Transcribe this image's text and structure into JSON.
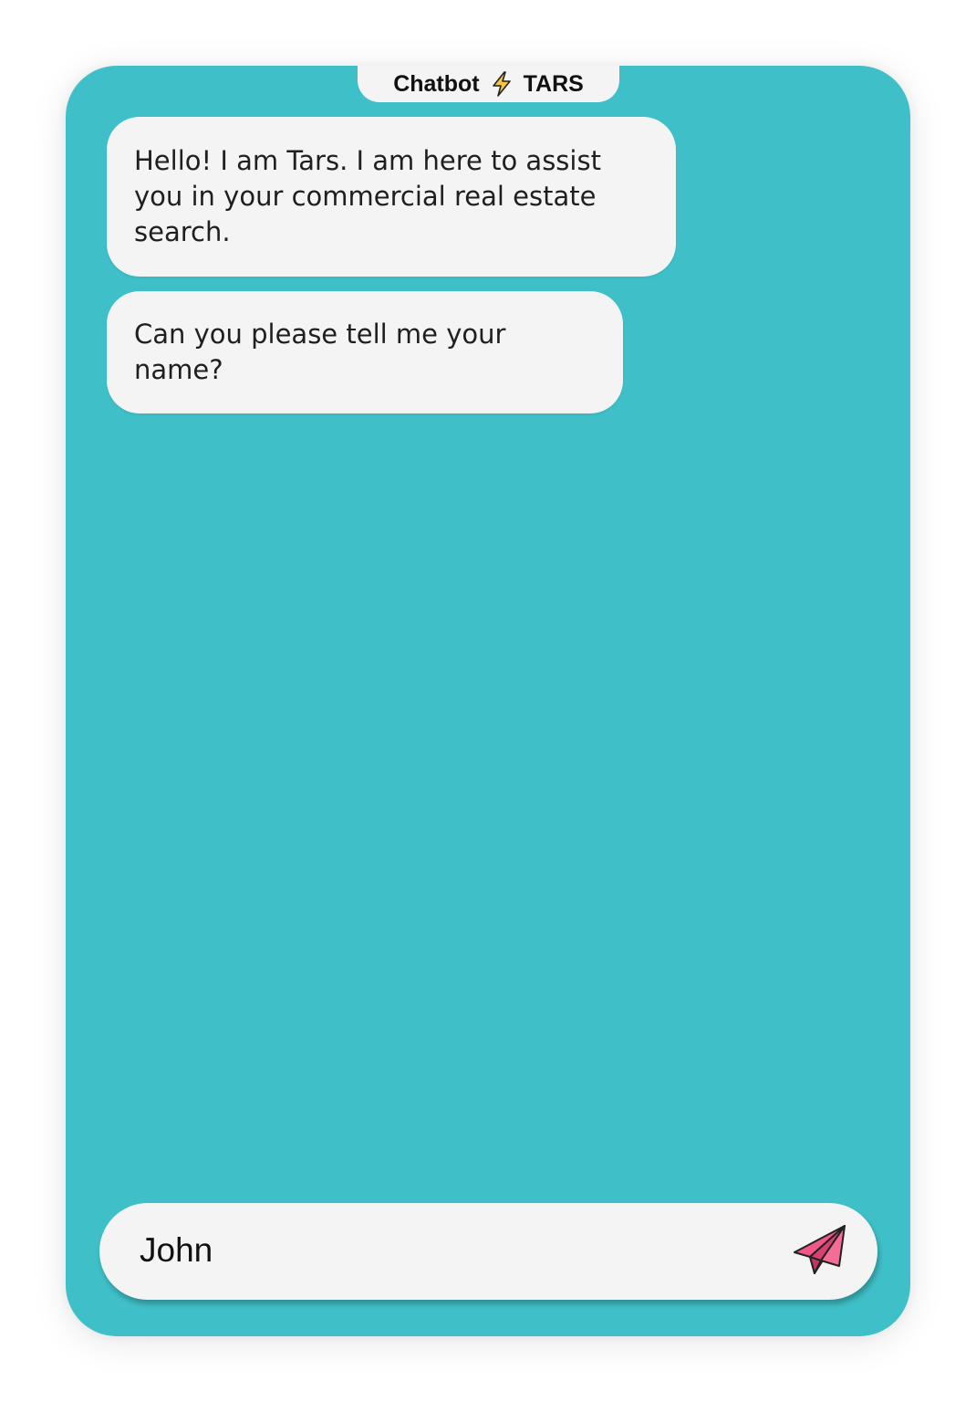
{
  "header": {
    "title_left": "Chatbot",
    "title_right": "TARS",
    "icon": "lightning-bolt-icon",
    "icon_color": "#f5c542"
  },
  "messages": [
    {
      "sender": "bot",
      "text": "Hello! I am Tars. I am here to assist you in your commercial real estate search."
    },
    {
      "sender": "bot",
      "text": "Can you please tell me your name?"
    }
  ],
  "composer": {
    "value": "John",
    "send_icon": "paper-plane-icon",
    "send_icon_color": "#f0588a"
  },
  "colors": {
    "background": "#3fc0c8",
    "bubble": "#f4f4f4"
  }
}
